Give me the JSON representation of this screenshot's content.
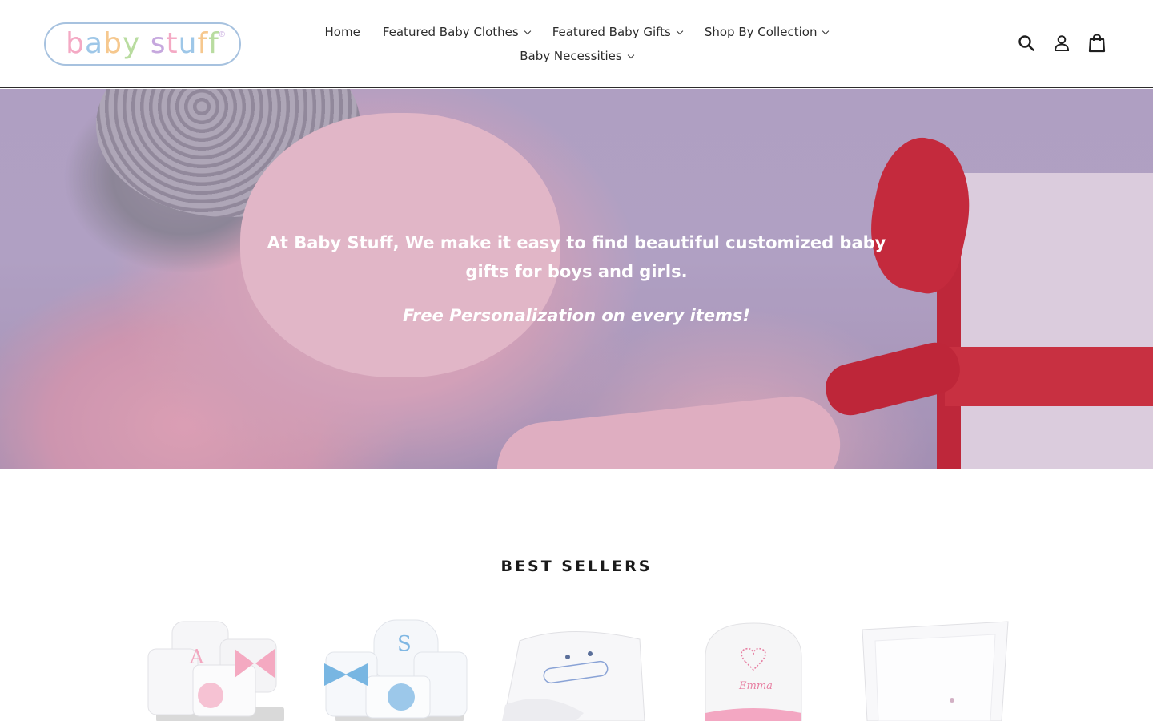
{
  "header": {
    "logo_text": "baby stuff",
    "logo_reg": "®",
    "nav_row1": [
      {
        "label": "Home",
        "has_dropdown": false
      },
      {
        "label": "Featured Baby Clothes",
        "has_dropdown": true
      },
      {
        "label": "Featured Baby Gifts",
        "has_dropdown": true
      },
      {
        "label": "Shop By Collection",
        "has_dropdown": true
      }
    ],
    "nav_row2": [
      {
        "label": "Baby Necessities",
        "has_dropdown": true
      }
    ],
    "icons": [
      "search-icon",
      "account-icon",
      "cart-icon"
    ]
  },
  "hero": {
    "headline": "At Baby Stuff, We make it easy to find beautiful customized baby gifts for boys and girls.",
    "subline": "Free Personalization on every items!"
  },
  "best_sellers": {
    "title": "BEST SELLERS",
    "products": [
      {
        "monogram": "A",
        "accent": "#f3a6bf"
      },
      {
        "monogram": "S",
        "accent": "#7fb7e3"
      },
      {
        "monogram": "",
        "accent": "#8aa3d6"
      },
      {
        "monogram": "Emma",
        "accent": "#e77fa2"
      },
      {
        "monogram": "",
        "accent": "#e9a1c0"
      }
    ]
  },
  "colors": {
    "header_border": "#2b2b2b",
    "hero_text": "#ffffff",
    "logo_border": "#a7c2df"
  }
}
